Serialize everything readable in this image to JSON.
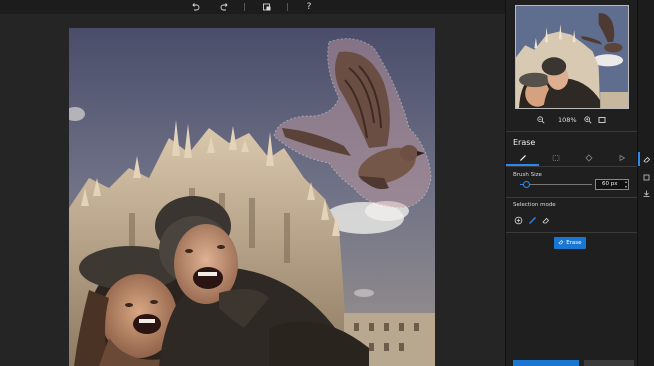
{
  "toolbar": {
    "undo_icon": "undo-icon",
    "redo_icon": "redo-icon",
    "compare_icon": "compare-icon",
    "help_label": "?"
  },
  "preview": {
    "zoom_label": "108%"
  },
  "panel": {
    "title": "Erase",
    "tabs": [
      "brush-icon",
      "rectangle-select-icon",
      "lasso-icon",
      "pointer-icon"
    ],
    "brush_size_label": "Brush Size",
    "brush_size_value": "60 px",
    "brush_size_fraction": 0.06,
    "selection_mode_label": "Selection mode",
    "erase_button_label": "Erase"
  },
  "colors": {
    "accent": "#2b8ae8",
    "button": "#1976d2",
    "panel_bg": "#1f1f1f",
    "canvas_bg": "#252525"
  }
}
